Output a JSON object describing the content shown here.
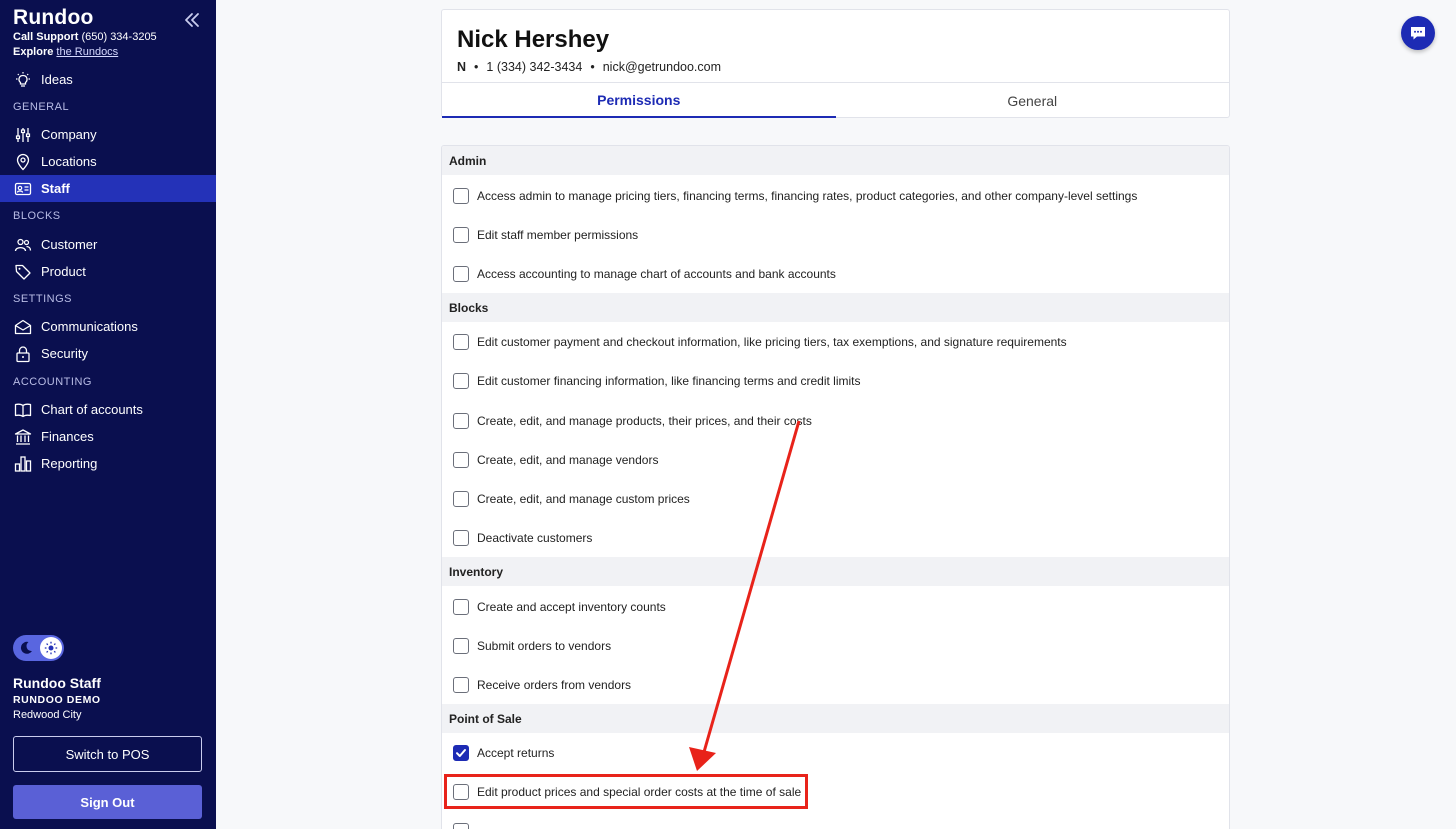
{
  "sidebar": {
    "brand": "Rundoo",
    "support_label": "Call Support",
    "support_phone": "(650) 334-3205",
    "explore_label": "Explore",
    "explore_link": "the Rundocs",
    "ideas": "Ideas",
    "sections": {
      "general": "GENERAL",
      "blocks": "BLOCKS",
      "settings": "SETTINGS",
      "accounting": "ACCOUNTING"
    },
    "items": {
      "company": "Company",
      "locations": "Locations",
      "staff": "Staff",
      "customer": "Customer",
      "product": "Product",
      "communications": "Communications",
      "security": "Security",
      "chart_of_accounts": "Chart of accounts",
      "finances": "Finances",
      "reporting": "Reporting"
    },
    "user": {
      "name": "Rundoo Staff",
      "org": "RUNDOO DEMO",
      "city": "Redwood City"
    },
    "switch_pos": "Switch to POS",
    "sign_out": "Sign Out"
  },
  "staff": {
    "name": "Nick Hershey",
    "initial": "N",
    "phone": "1 (334) 342-3434",
    "email": "nick@getrundoo.com",
    "separator": "•"
  },
  "tabs": {
    "permissions": "Permissions",
    "general": "General"
  },
  "permissions": {
    "admin": {
      "title": "Admin",
      "items": [
        {
          "label": "Access admin to manage pricing tiers, financing terms, financing rates, product categories, and other company-level settings",
          "checked": false
        },
        {
          "label": "Edit staff member permissions",
          "checked": false
        },
        {
          "label": "Access accounting to manage chart of accounts and bank accounts",
          "checked": false
        }
      ]
    },
    "blocks": {
      "title": "Blocks",
      "items": [
        {
          "label": "Edit customer payment and checkout information, like pricing tiers, tax exemptions, and signature requirements",
          "checked": false
        },
        {
          "label": "Edit customer financing information, like financing terms and credit limits",
          "checked": false
        },
        {
          "label": "Create, edit, and manage products, their prices, and their costs",
          "checked": false
        },
        {
          "label": "Create, edit, and manage vendors",
          "checked": false
        },
        {
          "label": "Create, edit, and manage custom prices",
          "checked": false
        },
        {
          "label": "Deactivate customers",
          "checked": false
        }
      ]
    },
    "inventory": {
      "title": "Inventory",
      "items": [
        {
          "label": "Create and accept inventory counts",
          "checked": false
        },
        {
          "label": "Submit orders to vendors",
          "checked": false
        },
        {
          "label": "Receive orders from vendors",
          "checked": false
        }
      ]
    },
    "pos": {
      "title": "Point of Sale",
      "items": [
        {
          "label": "Accept returns",
          "checked": true
        },
        {
          "label": "Edit product prices and special order costs at the time of sale",
          "checked": false
        }
      ]
    }
  },
  "colors": {
    "sidebar_bg": "#0a0f4f",
    "accent": "#1d2bb4",
    "annotation": "#e8231a"
  }
}
